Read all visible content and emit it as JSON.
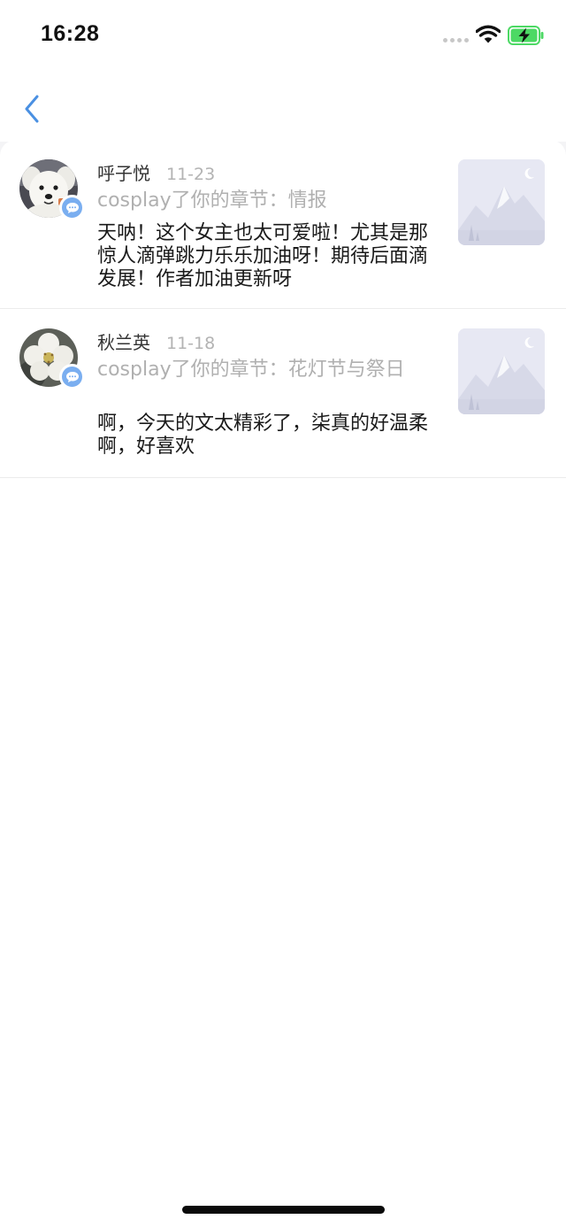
{
  "status_bar": {
    "time": "16:28",
    "signal_icon": "signal-dots-icon",
    "wifi_icon": "wifi-icon",
    "battery_icon": "battery-charging-icon",
    "battery_color": "#4cd964"
  },
  "nav": {
    "back_icon": "chevron-left-icon",
    "accent_color": "#4a90e2"
  },
  "notifications": [
    {
      "name": "呼子悦",
      "date": "11-23",
      "action": "cosplay了你的章节：情报",
      "comment": "天呐！这个女主也太可爱啦！尤其是那惊人滴弹跳力乐乐加油呀！期待后面滴发展！作者加油更新呀",
      "avatar": "dog-avatar",
      "badge_icon": "comment-bubble-icon",
      "thumbnail": "mountain-placeholder-image"
    },
    {
      "name": "秋兰英",
      "date": "11-18",
      "action": "cosplay了你的章节：花灯节与祭日",
      "comment": "啊，今天的文太精彩了，柒真的好温柔啊，好喜欢",
      "avatar": "flower-avatar",
      "badge_icon": "comment-bubble-icon",
      "thumbnail": "mountain-placeholder-image"
    }
  ]
}
